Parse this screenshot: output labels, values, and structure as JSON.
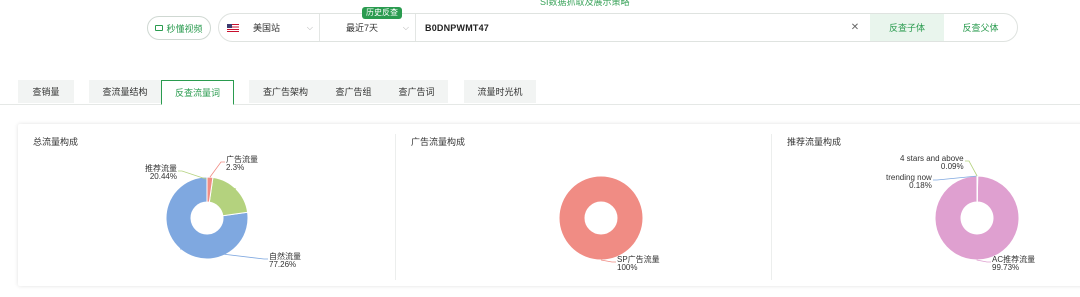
{
  "top_note": "SI数据抓取及展示策略",
  "video_button": {
    "label": "秒懂视频",
    "icon": "video-icon"
  },
  "search": {
    "site": "美国站",
    "site_icon": "us-flag-icon",
    "period_badge": "历史反查",
    "period": "最近7天",
    "asin": "B0DNPWMT47",
    "clear_icon": "close-icon",
    "child_button": "反查子体",
    "parent_button": "反查父体"
  },
  "tabs": [
    {
      "label": "查销量",
      "active": false
    },
    {
      "label": "查流量结构",
      "active": false
    },
    {
      "label": "反查流量词",
      "active": true
    },
    {
      "label": "查广告架构",
      "active": false
    },
    {
      "label": "查广告组",
      "active": false
    },
    {
      "label": "查广告词",
      "active": false
    },
    {
      "label": "流量时光机",
      "active": false
    }
  ],
  "chart_data": [
    {
      "type": "pie",
      "title": "总流量构成",
      "labels": [
        "自然流量",
        "推荐流量",
        "广告流量"
      ],
      "values": [
        77.26,
        20.44,
        2.3
      ],
      "value_labels": [
        "77.26%",
        "20.44%",
        "2.3%"
      ],
      "colors": [
        "#7fa8e0",
        "#b4d27e",
        "#f08c84"
      ]
    },
    {
      "type": "pie",
      "title": "广告流量构成",
      "labels": [
        "SP广告流量"
      ],
      "values": [
        100
      ],
      "value_labels": [
        "100%"
      ],
      "colors": [
        "#f08c84"
      ]
    },
    {
      "type": "pie",
      "title": "推荐流量构成",
      "labels": [
        "AC推荐流量",
        "trending now",
        "4 stars and above"
      ],
      "values": [
        99.73,
        0.18,
        0.09
      ],
      "value_labels": [
        "99.73%",
        "0.18%",
        "0.09%"
      ],
      "colors": [
        "#dfa0d0",
        "#7fa8e0",
        "#b4d27e"
      ]
    }
  ]
}
